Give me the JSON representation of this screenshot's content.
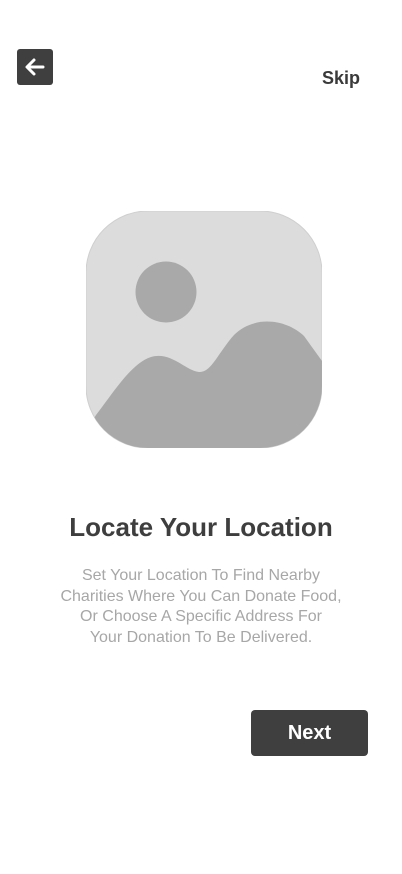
{
  "header": {
    "back_icon": "arrow-left-icon",
    "skip_label": "Skip"
  },
  "illustration": {
    "icon": "image-placeholder-icon"
  },
  "content": {
    "title": "Locate Your Location",
    "description_lines": [
      "Set Your Location To Find Nearby",
      "Charities Where You Can Donate Food,",
      "Or Choose A Specific Address For",
      "Your Donation To Be Delivered."
    ]
  },
  "actions": {
    "next_label": "Next"
  },
  "colors": {
    "primary_dark": "#3f3f3f",
    "title": "#3e3e3e",
    "description": "#a7a7a7",
    "placeholder_bg": "#dcdcdc",
    "placeholder_fg": "#a9a9a9"
  }
}
